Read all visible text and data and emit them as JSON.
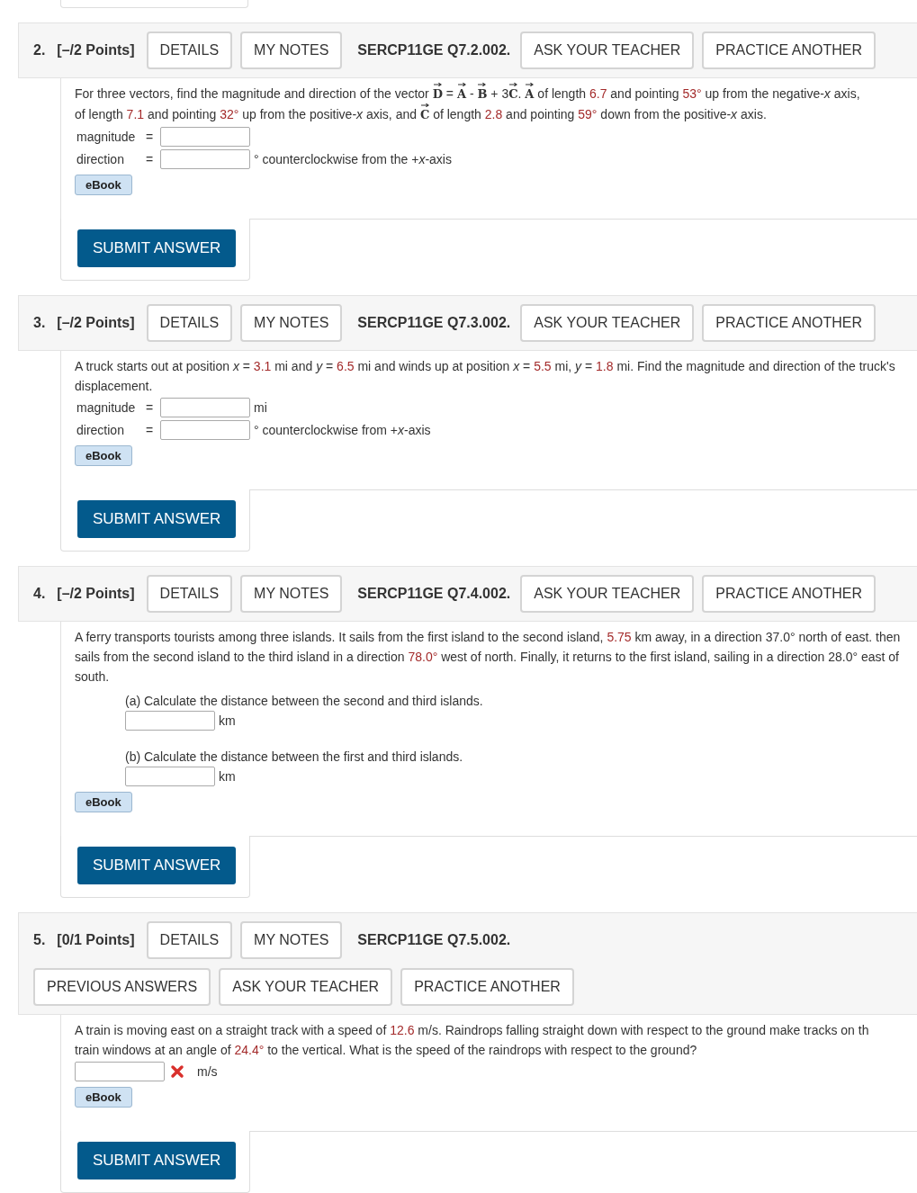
{
  "questions": [
    {
      "number": "2.",
      "points": "[–/2 Points]",
      "header_rows": [
        [
          {
            "kind": "button",
            "label": "DETAILS"
          },
          {
            "kind": "button",
            "label": "MY NOTES"
          },
          {
            "kind": "code",
            "label": "SERCP11GE Q7.2.002."
          },
          {
            "kind": "button",
            "label": "ASK YOUR TEACHER"
          },
          {
            "kind": "button",
            "label": "PRACTICE ANOTHER"
          }
        ]
      ],
      "paragraph": [
        {
          "kind": "text",
          "text": "For three vectors, find the magnitude and direction of the vector "
        },
        {
          "kind": "vector",
          "text": "D"
        },
        {
          "kind": "text",
          "text": " = "
        },
        {
          "kind": "vector",
          "text": "A"
        },
        {
          "kind": "text",
          "text": " - "
        },
        {
          "kind": "vector",
          "text": "B"
        },
        {
          "kind": "text",
          "text": " + 3"
        },
        {
          "kind": "vector",
          "text": "C"
        },
        {
          "kind": "text",
          "text": ". "
        },
        {
          "kind": "vector",
          "text": "A"
        },
        {
          "kind": "text",
          "text": " of length "
        },
        {
          "kind": "value",
          "text": "6.7"
        },
        {
          "kind": "text",
          "text": " and pointing "
        },
        {
          "kind": "value",
          "text": "53°"
        },
        {
          "kind": "text",
          "text": " up from the negative-*x* axis,"
        },
        {
          "kind": "break"
        },
        {
          "kind": "text",
          "text": "of length "
        },
        {
          "kind": "value",
          "text": "7.1"
        },
        {
          "kind": "text",
          "text": " and pointing "
        },
        {
          "kind": "value",
          "text": "32°"
        },
        {
          "kind": "text",
          "text": " up from the positive-*x* axis, and "
        },
        {
          "kind": "vector",
          "text": "C"
        },
        {
          "kind": "text",
          "text": " of length "
        },
        {
          "kind": "value",
          "text": "2.8"
        },
        {
          "kind": "text",
          "text": " and pointing "
        },
        {
          "kind": "value",
          "text": "59°"
        },
        {
          "kind": "text",
          "text": " down from the positive-*x* axis."
        }
      ],
      "fields": [
        {
          "kind": "labeled",
          "label": "magnitude",
          "equals": "="
        },
        {
          "kind": "labeled",
          "label": "direction",
          "equals": "=",
          "unit": "° counterclockwise from the +*x*-axis"
        }
      ],
      "ebook": "eBook",
      "submit": "SUBMIT ANSWER"
    },
    {
      "number": "3.",
      "points": "[–/2 Points]",
      "header_rows": [
        [
          {
            "kind": "button",
            "label": "DETAILS"
          },
          {
            "kind": "button",
            "label": "MY NOTES"
          },
          {
            "kind": "code",
            "label": "SERCP11GE Q7.3.002."
          },
          {
            "kind": "button",
            "label": "ASK YOUR TEACHER"
          },
          {
            "kind": "button",
            "label": "PRACTICE ANOTHER"
          }
        ]
      ],
      "paragraph": [
        {
          "kind": "text",
          "text": "A truck starts out at position *x* = "
        },
        {
          "kind": "value",
          "text": "3.1"
        },
        {
          "kind": "text",
          "text": " mi and *y* = "
        },
        {
          "kind": "value",
          "text": "6.5"
        },
        {
          "kind": "text",
          "text": " mi and winds up at position *x* = "
        },
        {
          "kind": "value",
          "text": "5.5"
        },
        {
          "kind": "text",
          "text": " mi, *y* = "
        },
        {
          "kind": "value",
          "text": "1.8"
        },
        {
          "kind": "text",
          "text": " mi. Find the magnitude and direction of the truck's displacement."
        }
      ],
      "fields": [
        {
          "kind": "labeled",
          "label": "magnitude",
          "equals": "=",
          "unit": "mi"
        },
        {
          "kind": "labeled",
          "label": "direction",
          "equals": "=",
          "unit": "° counterclockwise from +*x*-axis"
        }
      ],
      "ebook": "eBook",
      "submit": "SUBMIT ANSWER"
    },
    {
      "number": "4.",
      "points": "[–/2 Points]",
      "header_rows": [
        [
          {
            "kind": "button",
            "label": "DETAILS"
          },
          {
            "kind": "button",
            "label": "MY NOTES"
          },
          {
            "kind": "code",
            "label": "SERCP11GE Q7.4.002."
          },
          {
            "kind": "button",
            "label": "ASK YOUR TEACHER"
          },
          {
            "kind": "button",
            "label": "PRACTICE ANOTHER"
          }
        ]
      ],
      "paragraph": [
        {
          "kind": "text",
          "text": "A ferry transports tourists among three islands. It sails from the first island to the second island, "
        },
        {
          "kind": "value",
          "text": "5.75"
        },
        {
          "kind": "text",
          "text": " km away, in a direction 37.0° north of east. then sails from the second island to the third island in a direction "
        },
        {
          "kind": "value",
          "text": "78.0°"
        },
        {
          "kind": "text",
          "text": " west of north. Finally, it returns to the first island, sailing in a direction 28.0° east of south."
        }
      ],
      "fields": [
        {
          "kind": "part",
          "prompt": "(a) Calculate the distance between the second and third islands.",
          "unit": "km"
        },
        {
          "kind": "part",
          "prompt": "(b) Calculate the distance between the first and third islands.",
          "unit": "km"
        }
      ],
      "ebook": "eBook",
      "submit": "SUBMIT ANSWER"
    },
    {
      "number": "5.",
      "points": "[0/1 Points]",
      "header_rows": [
        [
          {
            "kind": "button",
            "label": "DETAILS"
          },
          {
            "kind": "button",
            "label": "MY NOTES"
          },
          {
            "kind": "code",
            "label": "SERCP11GE Q7.5.002."
          }
        ],
        [
          {
            "kind": "button",
            "label": "PREVIOUS ANSWERS"
          },
          {
            "kind": "button",
            "label": "ASK YOUR TEACHER"
          },
          {
            "kind": "button",
            "label": "PRACTICE ANOTHER"
          }
        ]
      ],
      "paragraph": [
        {
          "kind": "text",
          "text": "A train is moving east on a straight track with a speed of "
        },
        {
          "kind": "value",
          "text": "12.6"
        },
        {
          "kind": "text",
          "text": " m/s. Raindrops falling straight down with respect to the ground make tracks on th"
        },
        {
          "kind": "break"
        },
        {
          "kind": "text",
          "text": "train windows at an angle of "
        },
        {
          "kind": "value",
          "text": "24.4°"
        },
        {
          "kind": "text",
          "text": " to the vertical. What is the speed of the raindrops with respect to the ground?"
        }
      ],
      "fields": [
        {
          "kind": "bare",
          "incorrect": true,
          "unit": "m/s"
        }
      ],
      "ebook": "eBook",
      "submit": "SUBMIT ANSWER"
    }
  ]
}
